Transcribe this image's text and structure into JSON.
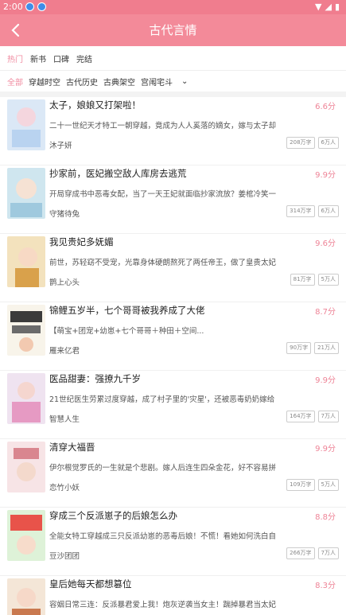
{
  "status": {
    "time": "2:00"
  },
  "appbar": {
    "title": "古代言情"
  },
  "sort": [
    "热门",
    "新书",
    "口碑",
    "完结"
  ],
  "categories": [
    "全部",
    "穿越时空",
    "古代历史",
    "古典架空",
    "宫闱宅斗"
  ],
  "colors": {
    "accent": "#f38a99",
    "score": "#ee8497",
    "active_tab": "#f08ba0"
  },
  "books": [
    {
      "title": "太子，娘娘又打架啦！",
      "score": "6.6分",
      "desc": "二十一世纪天才特工一朝穿越，竟成为人人奚落的嫡女，嫁与太子却",
      "author": "沐子妍",
      "words": "208万字",
      "readers": "6万人"
    },
    {
      "title": "抄家前，医妃搬空敌人库房去逃荒",
      "score": "9.9分",
      "desc": "开局穿成书中恶毒女配，当了一天王妃就面临抄家流放？姜棺冷笑一",
      "author": "守猪待兔",
      "words": "314万字",
      "readers": "6万人"
    },
    {
      "title": "我见贵妃多妩媚",
      "score": "9.6分",
      "desc": "前世，苏轻窈不受宠，光靠身体硬朗熬死了两任帝王，做了皇贵太妃",
      "author": "鹊上心头",
      "words": "81万字",
      "readers": "5万人"
    },
    {
      "title": "锦鲤五岁半，七个哥哥被我养成了大佬",
      "score": "8.7分",
      "desc": "【萌宝+团宠+幼崽+七个哥哥＋种田＋空间...",
      "author": "雁来亿君",
      "words": "90万字",
      "readers": "21万人"
    },
    {
      "title": "医品甜妻：强撩九千岁",
      "score": "9.9分",
      "desc": "21世纪医生劳累过度穿越，成了村子里的'灾星'，还被恶毒奶奶嫁给",
      "author": "智慧人生",
      "words": "164万字",
      "readers": "7万人"
    },
    {
      "title": "清穿大福晋",
      "score": "9.9分",
      "desc": "伊尔根觉罗氏的一生就是个悲剧。嫁人后连生四朵金花，好不容易拼",
      "author": "恋竹小妖",
      "words": "109万字",
      "readers": "5万人"
    },
    {
      "title": "穿成三个反派崽子的后娘怎么办",
      "score": "8.8分",
      "desc": "全能女特工穿越成三只反派幼崽的恶毒后娘！不慌！看她如何洗白自",
      "author": "豆沙团团",
      "words": "266万字",
      "readers": "7万人"
    },
    {
      "title": "皇后她每天都想篡位",
      "score": "8.3分",
      "desc": "容姻日常三连：反派暴君爱上我！炮灰逆袭当女主！踹掉暴君当太妃",
      "author": "",
      "words": "",
      "readers": ""
    }
  ]
}
